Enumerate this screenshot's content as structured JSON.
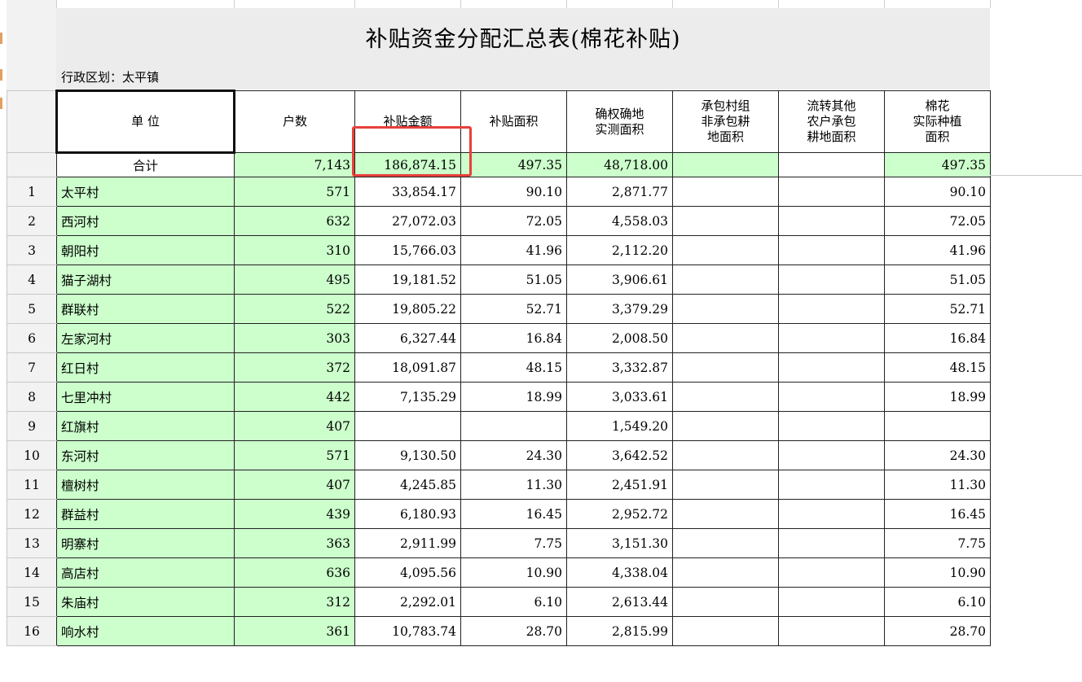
{
  "sheet": {
    "title": "补贴资金分配汇总表(棉花补贴)",
    "region_label": "行政区划：太平镇"
  },
  "headers": {
    "unit": "单 位",
    "households": "户数",
    "amount": "补贴金额",
    "area": "补贴面积",
    "measured": [
      "确权确地",
      "实测面积"
    ],
    "contract": [
      "承包村组",
      "非承包耕",
      "地面积"
    ],
    "transfer": [
      "流转其他",
      "农户承包",
      "耕地面积"
    ],
    "planted": [
      "棉花",
      "实际种植",
      "面积"
    ]
  },
  "total": {
    "label": "合计",
    "households": "7,143",
    "amount": "186,874.15",
    "area": "497.35",
    "measured": "48,718.00",
    "contract": "",
    "transfer": "",
    "planted": "497.35"
  },
  "rows": [
    {
      "no": "1",
      "name": "太平村",
      "households": "571",
      "amount": "33,854.17",
      "area": "90.10",
      "measured": "2,871.77",
      "planted": "90.10"
    },
    {
      "no": "2",
      "name": "西河村",
      "households": "632",
      "amount": "27,072.03",
      "area": "72.05",
      "measured": "4,558.03",
      "planted": "72.05"
    },
    {
      "no": "3",
      "name": "朝阳村",
      "households": "310",
      "amount": "15,766.03",
      "area": "41.96",
      "measured": "2,112.20",
      "planted": "41.96"
    },
    {
      "no": "4",
      "name": "猫子湖村",
      "households": "495",
      "amount": "19,181.52",
      "area": "51.05",
      "measured": "3,906.61",
      "planted": "51.05"
    },
    {
      "no": "5",
      "name": "群联村",
      "households": "522",
      "amount": "19,805.22",
      "area": "52.71",
      "measured": "3,379.29",
      "planted": "52.71"
    },
    {
      "no": "6",
      "name": "左家河村",
      "households": "303",
      "amount": "6,327.44",
      "area": "16.84",
      "measured": "2,008.50",
      "planted": "16.84"
    },
    {
      "no": "7",
      "name": "红日村",
      "households": "372",
      "amount": "18,091.87",
      "area": "48.15",
      "measured": "3,332.87",
      "planted": "48.15"
    },
    {
      "no": "8",
      "name": "七里冲村",
      "households": "442",
      "amount": "7,135.29",
      "area": "18.99",
      "measured": "3,033.61",
      "planted": "18.99"
    },
    {
      "no": "9",
      "name": "红旗村",
      "households": "407",
      "amount": "",
      "area": "",
      "measured": "1,549.20",
      "planted": ""
    },
    {
      "no": "10",
      "name": "东河村",
      "households": "571",
      "amount": "9,130.50",
      "area": "24.30",
      "measured": "3,642.52",
      "planted": "24.30"
    },
    {
      "no": "11",
      "name": "檀树村",
      "households": "407",
      "amount": "4,245.85",
      "area": "11.30",
      "measured": "2,451.91",
      "planted": "11.30"
    },
    {
      "no": "12",
      "name": "群益村",
      "households": "439",
      "amount": "6,180.93",
      "area": "16.45",
      "measured": "2,952.72",
      "planted": "16.45"
    },
    {
      "no": "13",
      "name": "明寨村",
      "households": "363",
      "amount": "2,911.99",
      "area": "7.75",
      "measured": "3,151.30",
      "planted": "7.75"
    },
    {
      "no": "14",
      "name": "高店村",
      "households": "636",
      "amount": "4,095.56",
      "area": "10.90",
      "measured": "4,338.04",
      "planted": "10.90"
    },
    {
      "no": "15",
      "name": "朱庙村",
      "households": "312",
      "amount": "2,292.01",
      "area": "6.10",
      "measured": "2,613.44",
      "planted": "6.10"
    },
    {
      "no": "16",
      "name": "响水村",
      "households": "361",
      "amount": "10,783.74",
      "area": "28.70",
      "measured": "2,815.99",
      "planted": "28.70"
    }
  ],
  "colors": {
    "green_fill": "#ccffcc",
    "highlight_border": "#e8403a",
    "row_header_fill": "#f2f2f2"
  }
}
